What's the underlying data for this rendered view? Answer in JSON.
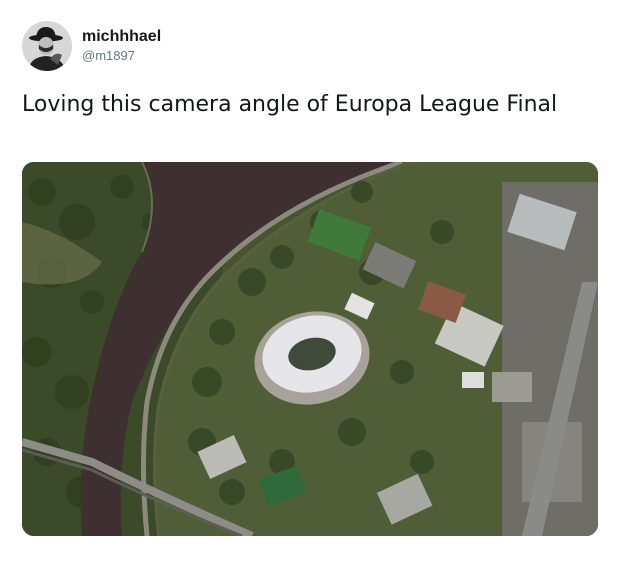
{
  "tweet": {
    "author": {
      "display_name": "michhhael",
      "handle": "@m1897",
      "avatar_icon": "person-with-hat-icon"
    },
    "text": "Loving this camera angle of Europa League Final",
    "media": {
      "subject_icon": "satellite-image-icon"
    }
  },
  "colors": {
    "name_text": "#14171a",
    "handle_text": "#657786",
    "river": "#3e2f31",
    "trees": "#3d4f2c",
    "stadium_roof": "#e6e6ea"
  }
}
